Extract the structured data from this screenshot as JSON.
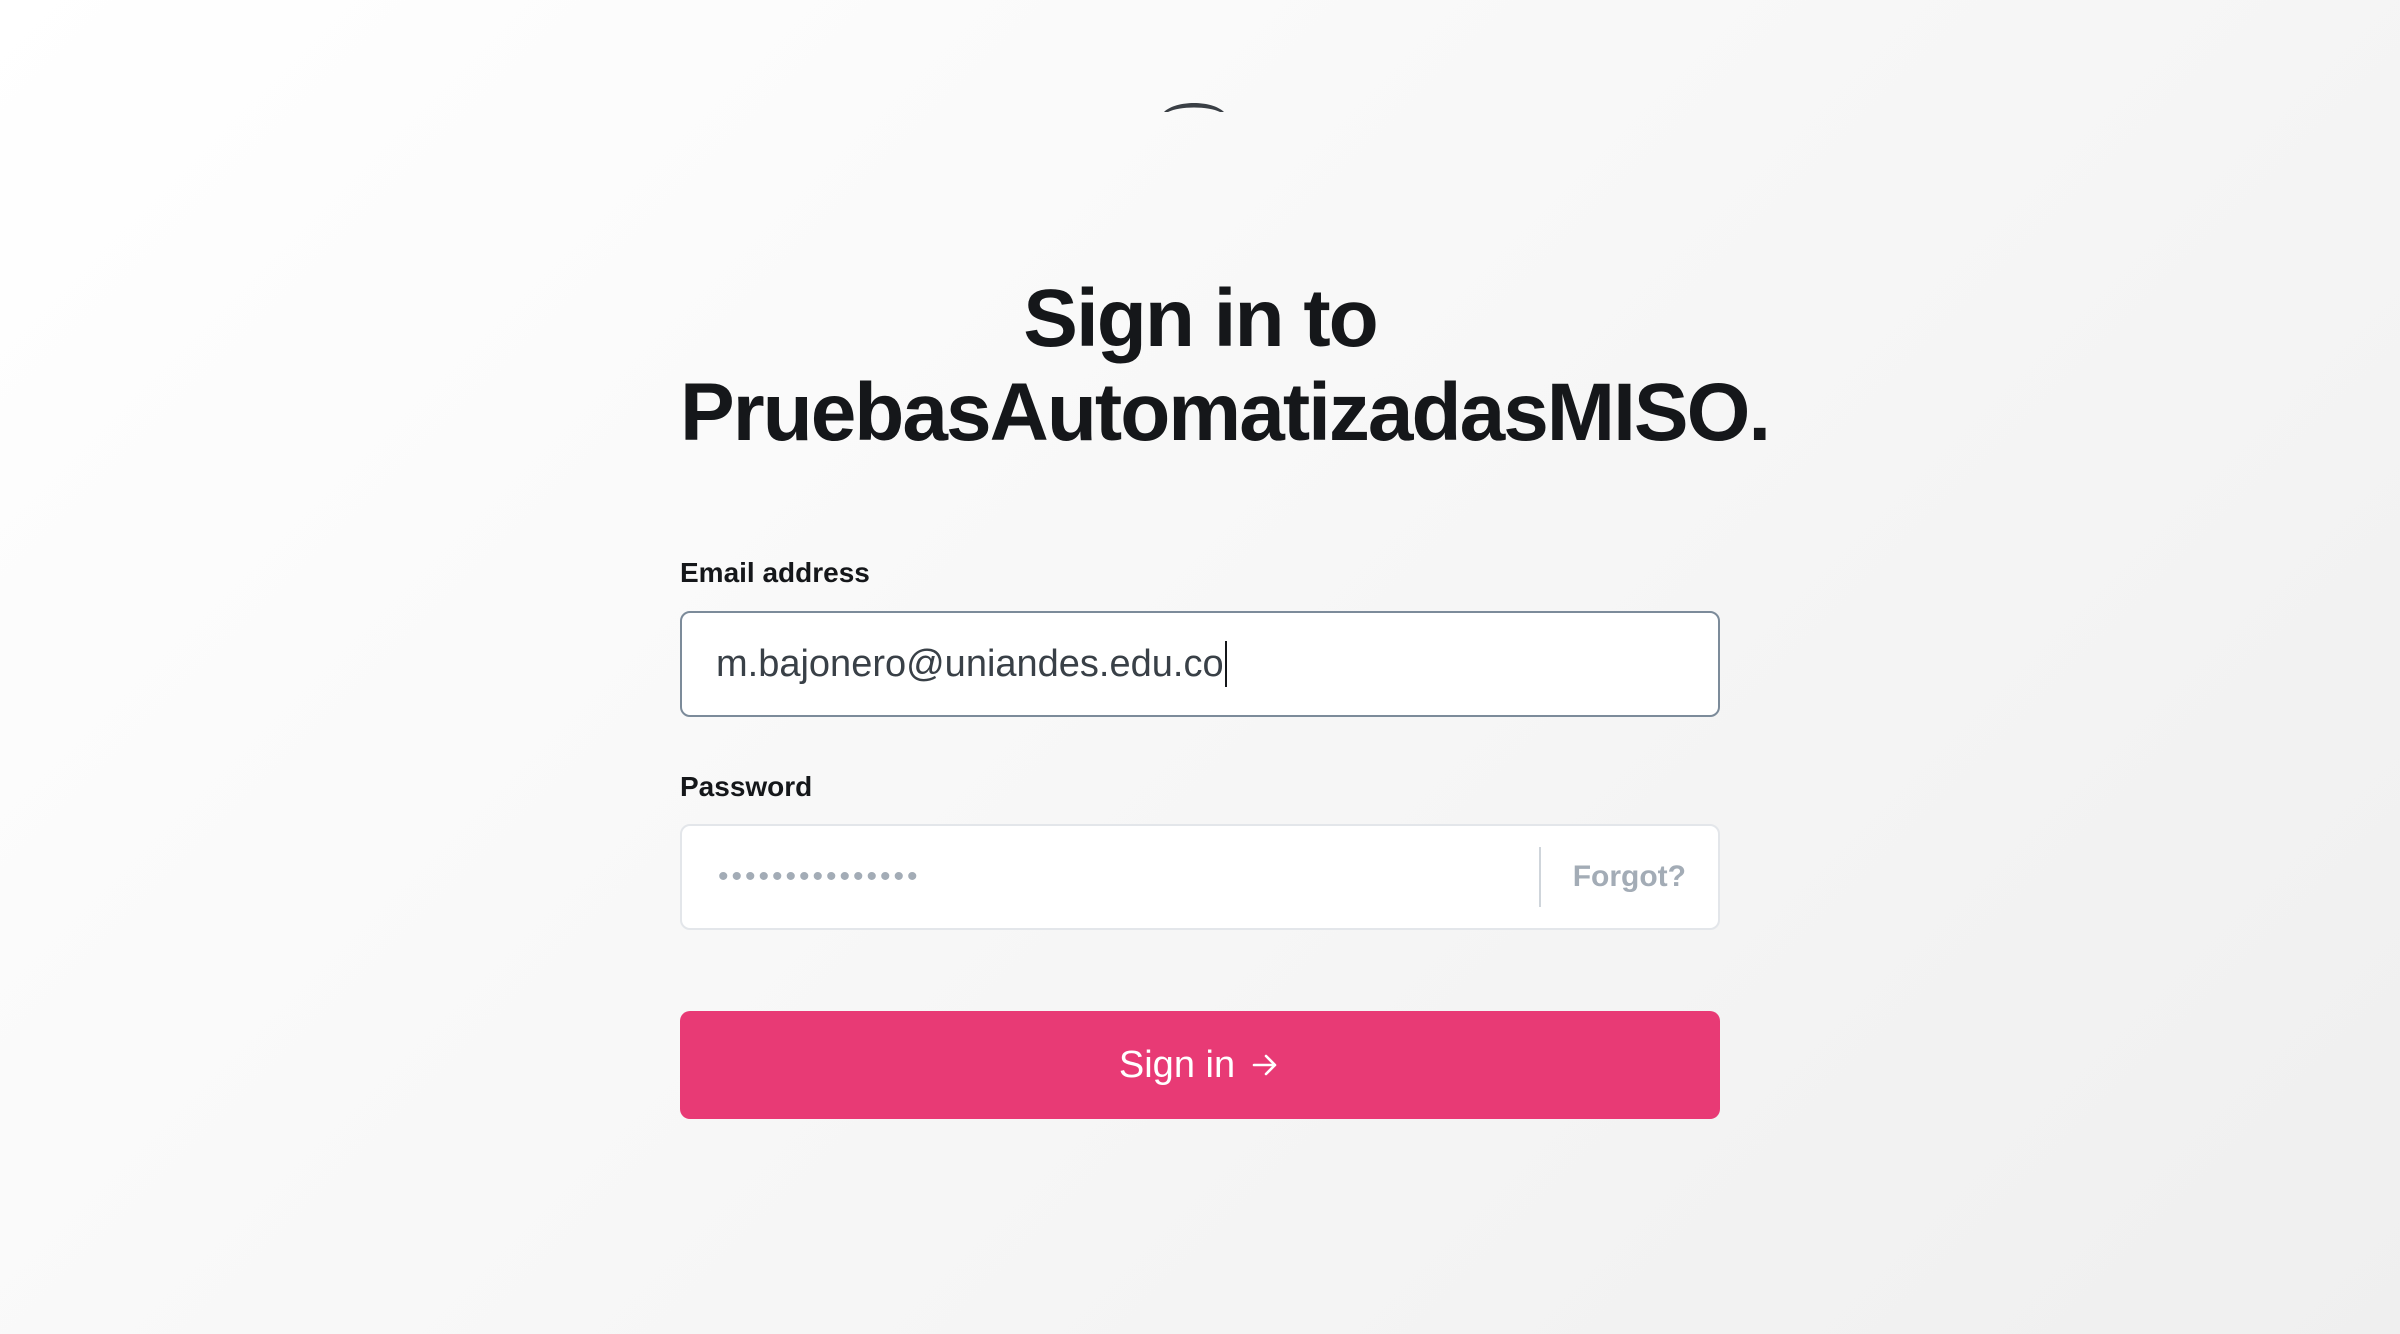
{
  "header": {
    "logo_icon": "ghost-logo-icon",
    "title_line1": "Sign in to",
    "title_line2": "PruebasAutomatizadasMISO."
  },
  "form": {
    "email_label": "Email address",
    "email_value": "m.bajonero@uniandes.edu.co",
    "password_label": "Password",
    "password_masked": "•••••••••••••••",
    "forgot_label": "Forgot?",
    "submit_label": "Sign in",
    "submit_icon": "arrow-right-icon"
  },
  "colors": {
    "accent": "#e83a75",
    "text": "#15171a",
    "muted": "#a3acb6"
  }
}
